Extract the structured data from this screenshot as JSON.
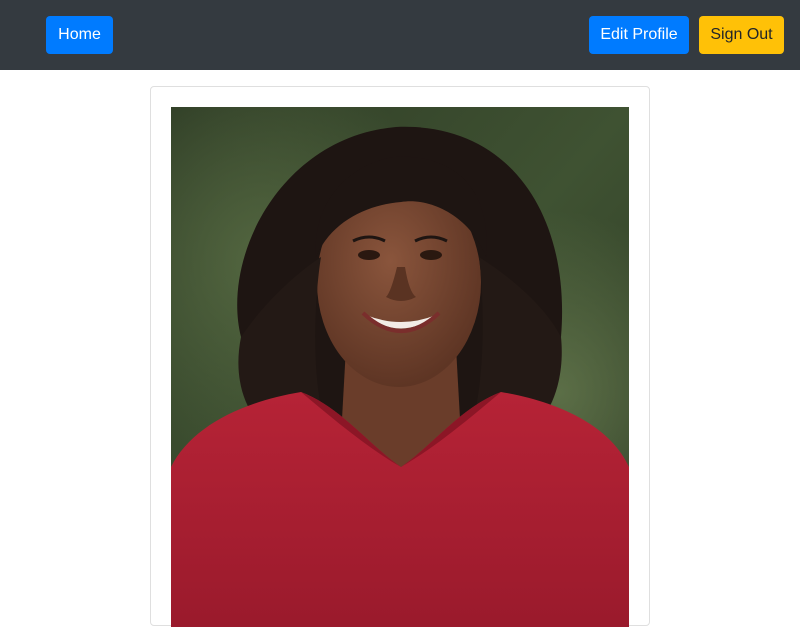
{
  "navbar": {
    "home_label": "Home",
    "edit_profile_label": "Edit Profile",
    "sign_out_label": "Sign Out"
  },
  "colors": {
    "navbar_bg": "#343a40",
    "primary": "#007bff",
    "warning": "#ffc107"
  },
  "profile": {
    "photo_icon": "portrait-photo"
  }
}
